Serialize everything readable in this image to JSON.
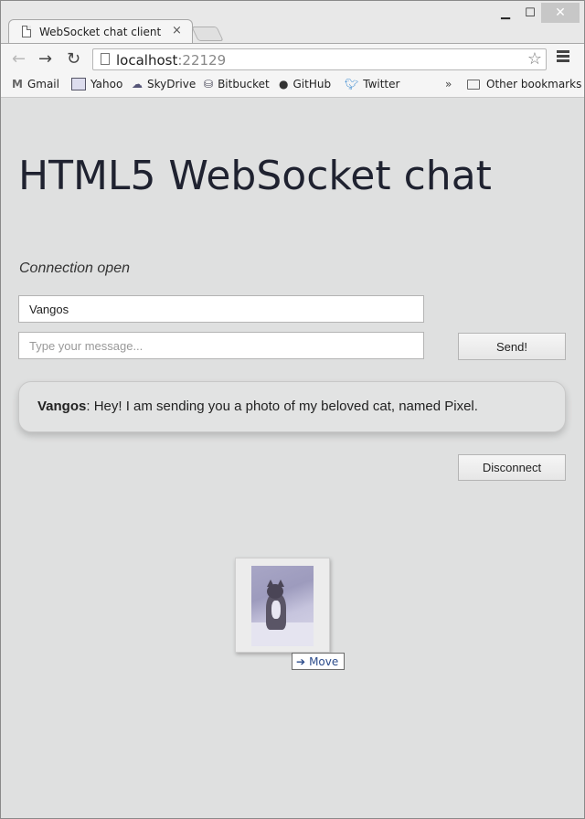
{
  "browser": {
    "tab_title": "WebSocket chat client",
    "tab_close": "×",
    "url_host": "localhost",
    "url_port": ":22129",
    "window_controls": {
      "minimize": "▁",
      "maximize": "☐",
      "close": "✕"
    },
    "nav": {
      "back": "←",
      "forward": "→",
      "reload": "↻",
      "star": "☆"
    },
    "bookmarks": [
      {
        "label": "Gmail",
        "icon": "gmail-icon"
      },
      {
        "label": "Yahoo",
        "icon": "yahoo-icon"
      },
      {
        "label": "SkyDrive",
        "icon": "skydrive-icon"
      },
      {
        "label": "Bitbucket",
        "icon": "bitbucket-icon"
      },
      {
        "label": "GitHub",
        "icon": "github-icon"
      },
      {
        "label": "Twitter",
        "icon": "twitter-icon"
      }
    ],
    "bookmarks_more": "»",
    "other_bookmarks": "Other bookmarks"
  },
  "page": {
    "title": "HTML5 WebSocket chat",
    "status": "Connection open",
    "name_value": "Vangos",
    "message_placeholder": "Type your message...",
    "send_label": "Send!",
    "disconnect_label": "Disconnect",
    "messages": [
      {
        "sender": "Vangos",
        "text": ": Hey! I am sending you a photo of my beloved cat, named Pixel."
      }
    ]
  },
  "drag": {
    "tooltip": "Move"
  },
  "colors": {
    "page_background": "#dfe0e0",
    "title_text": "#1f2230",
    "link_blue": "#2b4b8a"
  }
}
